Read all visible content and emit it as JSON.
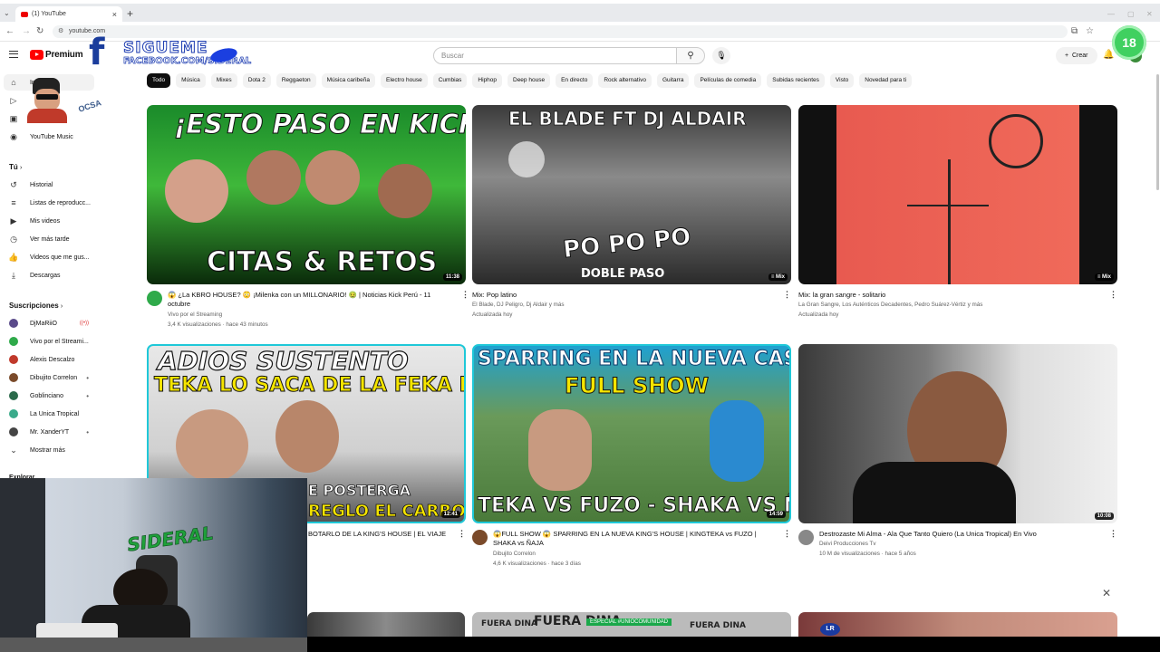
{
  "browser": {
    "tab_title": "(1) YouTube",
    "url": "youtube.com"
  },
  "masthead": {
    "logo_text": "Premium",
    "search_placeholder": "Buscar",
    "create_label": "Crear"
  },
  "overlay": {
    "sigueme": "SIGUEME",
    "facebook": "FACEBOOK.COM/SIDERAL",
    "age_badge": "18",
    "ocsa": "OCSA",
    "webcam_logo": "SIDERAL"
  },
  "sidebar": {
    "home_label": "Inicio",
    "yt_music": "YouTube Music",
    "tu_header": "Tú",
    "items": [
      {
        "label": "Historial",
        "icon": "history-icon"
      },
      {
        "label": "Listas de reproducc...",
        "icon": "playlist-icon"
      },
      {
        "label": "Mis videos",
        "icon": "my-videos-icon"
      },
      {
        "label": "Ver más tarde",
        "icon": "watch-later-icon"
      },
      {
        "label": "Videos que me gus...",
        "icon": "like-icon"
      },
      {
        "label": "Descargas",
        "icon": "download-icon"
      }
    ],
    "subs_header": "Suscripciones",
    "subs": [
      {
        "label": "DjMaRiiO",
        "color": "#5a4a8a",
        "flag": "live"
      },
      {
        "label": "Vivo por el Streami...",
        "color": "#2faa4a",
        "flag": ""
      },
      {
        "label": "Alexis Descalzo",
        "color": "#c0392b",
        "flag": ""
      },
      {
        "label": "Dibujito Correlon",
        "color": "#7a4a2a",
        "flag": "new"
      },
      {
        "label": "Goblinciano",
        "color": "#2a6a4a",
        "flag": "new"
      },
      {
        "label": "La Unica Tropical",
        "color": "#3aaa8a",
        "flag": ""
      },
      {
        "label": "Mr. XanderYT",
        "color": "#444444",
        "flag": "new"
      }
    ],
    "show_more": "Mostrar más",
    "explore": "Explorar"
  },
  "chips": [
    "Todo",
    "Música",
    "Mixes",
    "Dota 2",
    "Reggaeton",
    "Música caribeña",
    "Electro house",
    "Cumbias",
    "Hiphop",
    "Deep house",
    "En directo",
    "Rock alternativo",
    "Guitarra",
    "Películas de comedia",
    "Subidas recientes",
    "Visto",
    "Novedad para ti"
  ],
  "videos": [
    {
      "thumb_text_top": "¡ESTO PASO EN KICK!",
      "thumb_text_bottom": "CITAS & RETOS",
      "duration": "11:38",
      "title": "😱 ¿La KBRO HOUSE? 😳 ¡Milenka con un MILLONARIO! 🤢 | Noticias Kick Perú - 11 octubre",
      "channel": "Vivo por el Streaming",
      "stats": "3,4 K visualizaciones · hace 43 minutos"
    },
    {
      "thumb_text_top": "EL BLADE FT DJ ALDAIR",
      "thumb_text_mid": "PO PO PO",
      "thumb_text_bottom": "DOBLE PASO",
      "duration": "Mix",
      "title": "Mix: Pop latino",
      "channel": "El Blade, DJ Peligro, Dj Aldair y más",
      "stats": "Actualizada hoy"
    },
    {
      "duration": "Mix",
      "title": "Mix: la gran sangre - solitario",
      "channel": "La Gran Sangre, Los Auténticos Decadentes, Pedro Suárez-Vértiz y más",
      "stats": "Actualizada hoy"
    },
    {
      "thumb_text_top": "ADIOS SUSTENTO",
      "thumb_text_mid": "TEKA LO SACA DE LA FEKA HOUSE",
      "thumb_text_bottom": "E POSTERGA",
      "thumb_text_bottom2": "REGLO EL CARRO",
      "duration": "12:41",
      "title": "BOTARLO DE LA KING'S HOUSE | EL VIAJE"
    },
    {
      "thumb_text_top": "SPARRING EN LA NUEVA CASA",
      "thumb_text_mid": "FULL SHOW",
      "thumb_text_bottom": "TEKA VS FUZO - SHAKA VS ÑAKA",
      "duration": "14:59",
      "title": "😱FULL SHOW 😱 SPARRING EN LA NUEVA KING'S HOUSE | KINGTEKA vs FUZO | SHAKA vs ÑAJA",
      "channel": "Dibujito Correlon",
      "stats": "4,6 K visualizaciones · hace 3 días"
    },
    {
      "duration": "10:08",
      "title": "Destrozaste Mi Alma - Ala Que Tanto Quiero (La Unica Tropical) En Vivo",
      "channel": "Deivi Producciones Tv",
      "stats": "10 M de visualizaciones · hace 5 años"
    }
  ],
  "row3": {
    "fuera_dina": "FUERA DINA",
    "especial": "ESPECIAL #UNIOCOMUNIDAD",
    "lr": "LR"
  }
}
